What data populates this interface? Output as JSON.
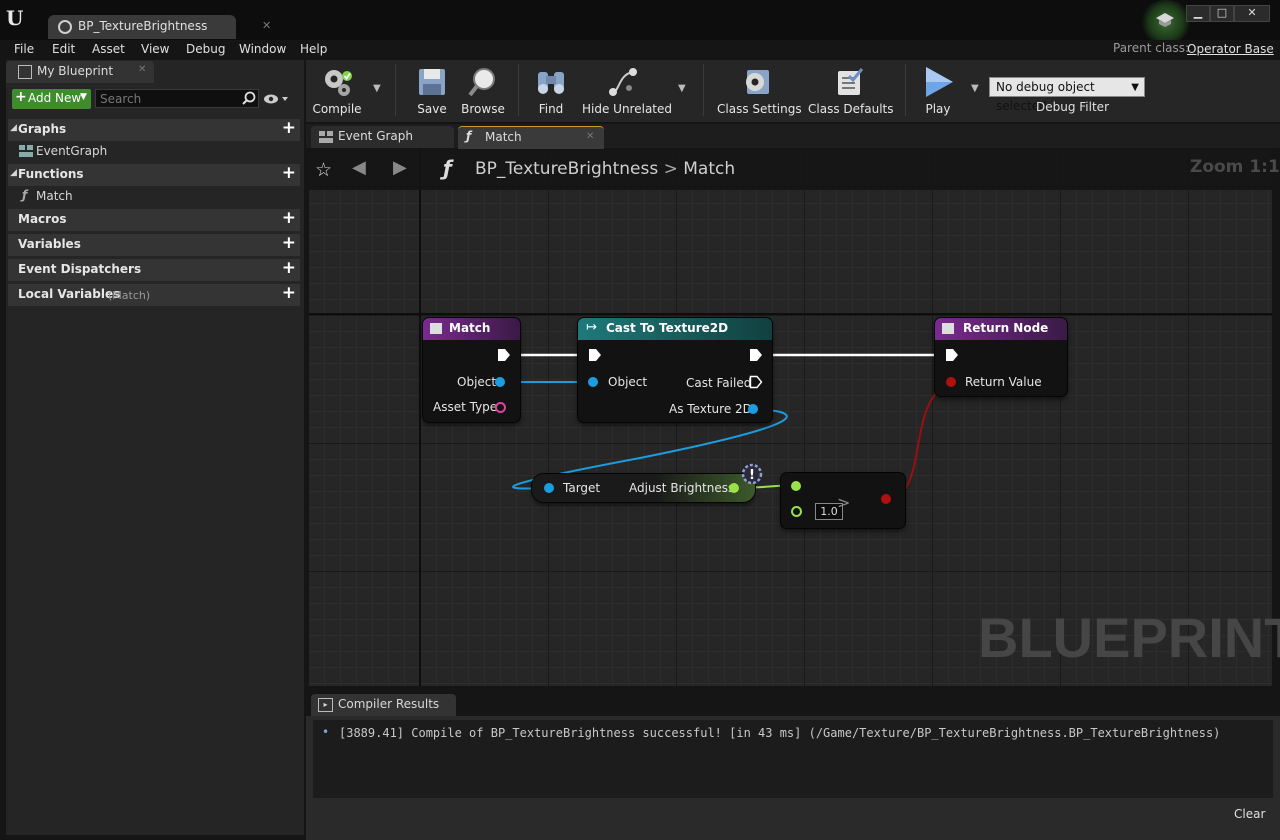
{
  "window": {
    "doc_tab": "BP_TextureBrightness",
    "parent_label": "Parent class:",
    "parent_value": "Operator Base"
  },
  "menu": [
    "File",
    "Edit",
    "Asset",
    "View",
    "Debug",
    "Window",
    "Help"
  ],
  "my_blueprint": {
    "tab": "My Blueprint",
    "add_new": "Add New",
    "search_placeholder": "Search",
    "graphs": {
      "label": "Graphs",
      "items": [
        "EventGraph"
      ]
    },
    "functions": {
      "label": "Functions",
      "items": [
        "Match"
      ]
    },
    "macros": "Macros",
    "variables": "Variables",
    "event_dispatchers": "Event Dispatchers",
    "local_variables": "Local Variables",
    "local_variables_scope": "(Match)"
  },
  "toolbar": {
    "compile": "Compile",
    "save": "Save",
    "browse": "Browse",
    "find": "Find",
    "hide_unrelated": "Hide Unrelated",
    "class_settings": "Class Settings",
    "class_defaults": "Class Defaults",
    "play": "Play",
    "debug_object": "No debug object selected",
    "debug_filter": "Debug Filter"
  },
  "graph_tabs": [
    "Event Graph",
    "Match"
  ],
  "graph": {
    "breadcrumb_root": "BP_TextureBrightness",
    "breadcrumb_sep": ">",
    "breadcrumb_leaf": "Match",
    "zoom": "Zoom 1:1",
    "watermark": "BLUEPRINT",
    "nodes": {
      "match": {
        "title": "Match",
        "pin_object": "Object",
        "pin_asset_type": "Asset Type"
      },
      "cast": {
        "title": "Cast To Texture2D",
        "pin_object": "Object",
        "pin_cast_failed": "Cast Failed",
        "pin_as_texture": "As Texture 2D"
      },
      "return": {
        "title": "Return Node",
        "pin_return_value": "Return Value"
      },
      "adjust": {
        "pin_target": "Target",
        "pin_adjust": "Adjust Brightness"
      },
      "compare": {
        "default_value": "1.0"
      }
    },
    "colors": {
      "exec": "#ffffff",
      "object": "#1a9ee0",
      "asset_type": "#e040a0",
      "float": "#9be24a",
      "bool": "#b01010"
    }
  },
  "compiler": {
    "tab": "Compiler Results",
    "message": "[3889.41] Compile of BP_TextureBrightness successful! [in 43 ms] (/Game/Texture/BP_TextureBrightness.BP_TextureBrightness)",
    "clear": "Clear"
  }
}
